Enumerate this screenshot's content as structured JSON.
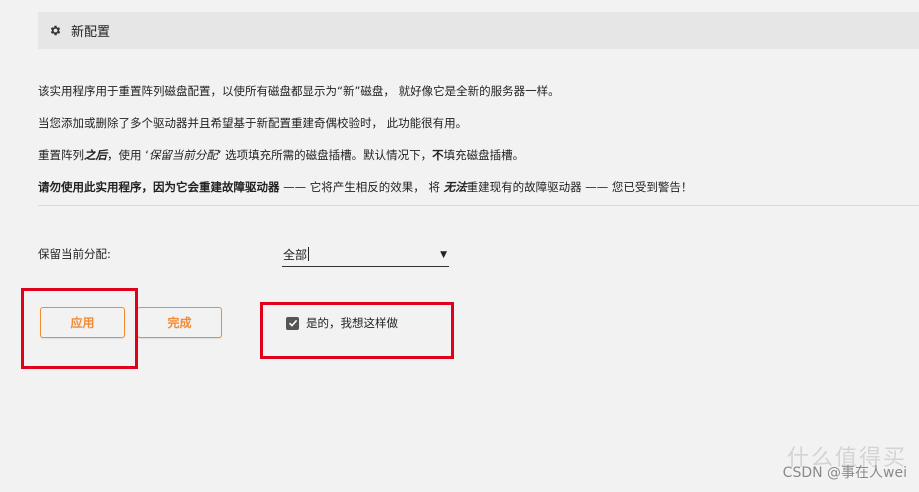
{
  "header": {
    "icon": "gear-icon",
    "title": "新配置"
  },
  "description": {
    "line1": "该实用程序用于重置阵列磁盘配置，以使所有磁盘都显示为“新”磁盘， 就好像它是全新的服务器一样。",
    "line2": "当您添加或删除了多个驱动器并且希望基于新配置重建奇偶校验时， 此功能很有用。",
    "line3": {
      "part1": "重置阵列",
      "part2_italic_bold": "之后",
      "part3": "，使用 ‘",
      "part4_italic": "保留当前分配",
      "part5": "’ 选项填充所需的磁盘插槽。默认情况下，",
      "part6_bold": "不",
      "part7": "填充磁盘插槽。"
    },
    "line4": {
      "part1_bold": "请勿使用此实用程序，因为它会重建故障驱动器",
      "part2": " —— 它将产生相反的效果， 将 ",
      "part3_bold_italic": "无法",
      "part4": "重建现有的故障驱动器 —— 您已受到警告！"
    }
  },
  "form": {
    "preserve_label": "保留当前分配:",
    "preserve_value": "全部",
    "apply_label": "应用",
    "done_label": "完成",
    "confirm_label": "是的，我想这样做",
    "confirm_checked": true
  },
  "watermark": {
    "big": "什么值得买",
    "small": "CSDN @事在人wei"
  },
  "colors": {
    "accent": "#f28c33",
    "highlight": "#e0001b",
    "background": "#f2f2f2"
  }
}
